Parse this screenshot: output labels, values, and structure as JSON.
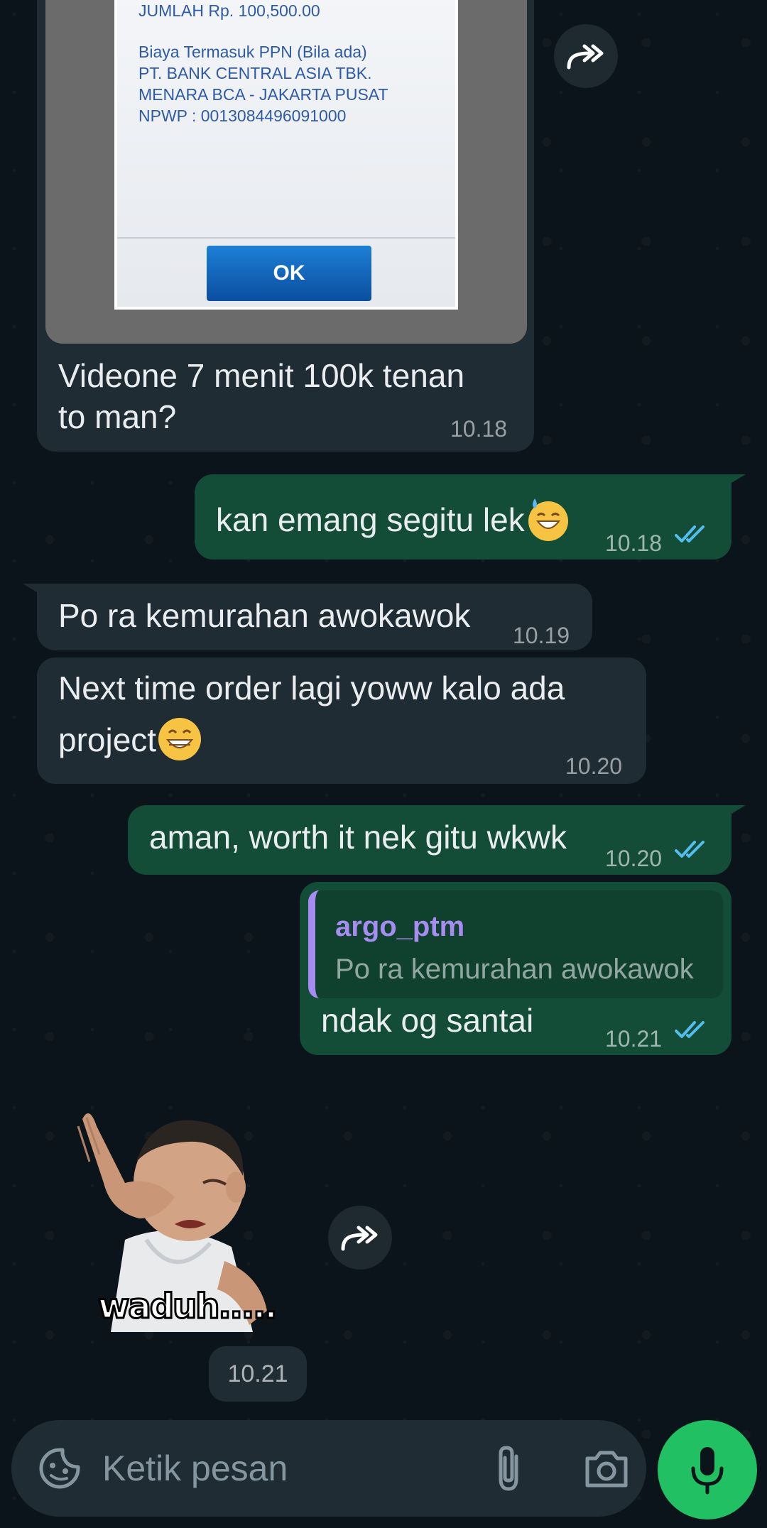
{
  "receipt": {
    "amount_line": "JUMLAH Rp. 100,500.00",
    "info_lines": [
      "Biaya Termasuk PPN (Bila ada)",
      "PT. BANK CENTRAL ASIA TBK.",
      "MENARA BCA - JAKARTA PUSAT",
      "NPWP : 0013084496091000"
    ],
    "ok_label": "OK"
  },
  "messages": [
    {
      "direction": "in",
      "text_lines": [
        "Videone 7 menit 100k tenan",
        "to man?"
      ],
      "time": "10.18"
    },
    {
      "direction": "out",
      "text": "kan emang segitu lek",
      "emoji": "sweat-smile-emoji",
      "time": "10.18",
      "status": "read"
    },
    {
      "direction": "in",
      "text": "Po ra kemurahan awokawok",
      "time": "10.19"
    },
    {
      "direction": "in",
      "text_lines": [
        "Next time order lagi yoww kalo ada",
        "project"
      ],
      "emoji": "grinning-emoji",
      "time": "10.20"
    },
    {
      "direction": "out",
      "text": "aman, worth it nek gitu wkwk",
      "time": "10.20",
      "status": "read"
    },
    {
      "direction": "out",
      "quote": {
        "author": "argo_ptm",
        "text": "Po ra kemurahan awokawok"
      },
      "text": "ndak og santai",
      "time": "10.21",
      "status": "read"
    }
  ],
  "sticker": {
    "caption": "waduh.....",
    "time": "10.21"
  },
  "composer": {
    "placeholder": "Ketik pesan",
    "icons": [
      "sticker-icon",
      "paperclip-icon",
      "camera-icon",
      "microphone-icon"
    ]
  },
  "colors": {
    "incoming_bubble": "#1f2c34",
    "outgoing_bubble": "#144d37",
    "read_ticks": "#53bdeb",
    "mic_button": "#21c063",
    "quote_bar": "#a68cf0"
  }
}
